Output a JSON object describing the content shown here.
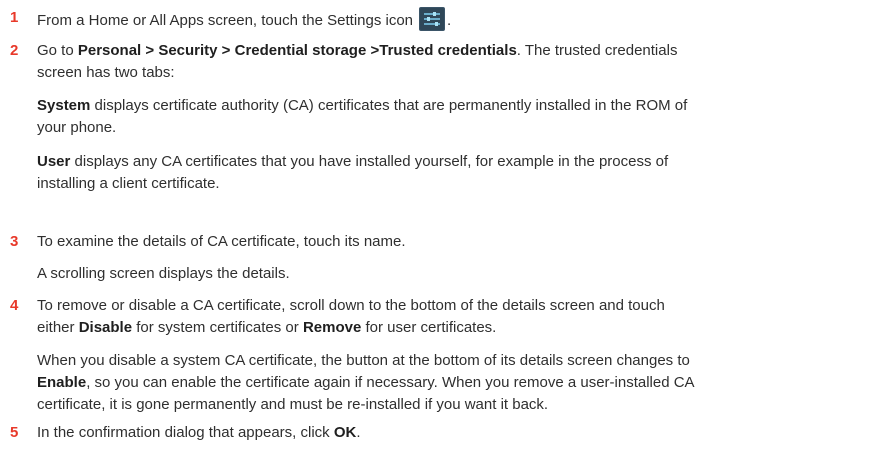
{
  "steps": [
    {
      "number": "1",
      "text_before_icon": "From a Home or All Apps screen, touch the Settings icon",
      "text_after_icon": "."
    },
    {
      "number": "2",
      "intro_a": "Go to ",
      "intro_bold": "Personal > Security > Credential storage >Trusted credentials",
      "intro_b": ". The trusted credentials",
      "intro_line2": "screen has two tabs:",
      "tab_system_label": "System",
      "tab_system_line1": " displays certificate authority (CA) certificates that are permanently installed in the ROM of",
      "tab_system_line2": "your phone.",
      "tab_user_label": "User",
      "tab_user_line1": " displays any CA certificates that you have installed yourself, for example in the process of",
      "tab_user_line2": "installing a client certificate."
    },
    {
      "number": "3",
      "line1": "To examine the details of CA certificate, touch its name.",
      "line2": "A scrolling screen displays the details."
    },
    {
      "number": "4",
      "line1": "To remove or disable a CA certificate, scroll down to the bottom of the details screen and touch",
      "line2_a": "either ",
      "line2_bold1": "Disable",
      "line2_b": " for system certificates or ",
      "line2_bold2": "Remove",
      "line2_c": " for user certificates.",
      "note_line1": "When you disable a system CA certificate, the button at the bottom of its details screen changes to",
      "note_line2_bold": "Enable",
      "note_line2_rest": ", so you can enable the certificate again if necessary. When you remove a user-installed CA",
      "note_line3": "certificate, it is gone permanently and must be re-installed if you want it back."
    },
    {
      "number": "5",
      "text_a": "In the confirmation dialog that appears, click ",
      "text_bold": "OK",
      "text_b": "."
    }
  ],
  "icons": {
    "settings": "settings-icon"
  },
  "colors": {
    "step_number": "#e8392a",
    "text": "#2f2f2f"
  }
}
